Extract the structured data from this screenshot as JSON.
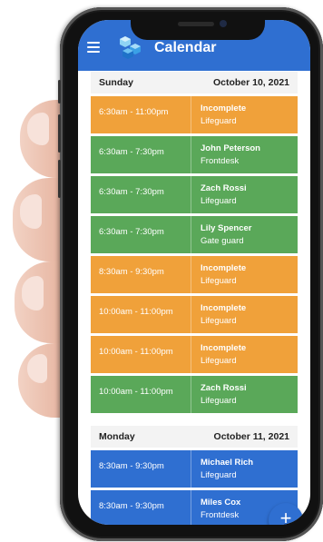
{
  "app": {
    "title": "Calendar",
    "menu_icon": "menu-icon",
    "logo_icon": "cubes-logo-icon"
  },
  "colors": {
    "primary": "#2f6fd1",
    "incomplete": "#f0a13a",
    "assigned": "#5aa859",
    "header_bg": "#f3f3f3"
  },
  "days": [
    {
      "day": "Sunday",
      "date": "October 10, 2021",
      "shifts": [
        {
          "time": "6:30am - 11:00pm",
          "name": "Incomplete",
          "role": "Lifeguard",
          "status": "incomplete"
        },
        {
          "time": "6:30am - 7:30pm",
          "name": "John Peterson",
          "role": "Frontdesk",
          "status": "assigned"
        },
        {
          "time": "6:30am - 7:30pm",
          "name": "Zach Rossi",
          "role": "Lifeguard",
          "status": "assigned"
        },
        {
          "time": "6:30am - 7:30pm",
          "name": "Lily Spencer",
          "role": "Gate guard",
          "status": "assigned"
        },
        {
          "time": "8:30am - 9:30pm",
          "name": "Incomplete",
          "role": "Lifeguard",
          "status": "incomplete"
        },
        {
          "time": "10:00am - 11:00pm",
          "name": "Incomplete",
          "role": "Lifeguard",
          "status": "incomplete"
        },
        {
          "time": "10:00am - 11:00pm",
          "name": "Incomplete",
          "role": "Lifeguard",
          "status": "incomplete"
        },
        {
          "time": "10:00am - 11:00pm",
          "name": "Zach Rossi",
          "role": "Lifeguard",
          "status": "assigned"
        }
      ]
    },
    {
      "day": "Monday",
      "date": "October 11, 2021",
      "shifts": [
        {
          "time": "8:30am - 9:30pm",
          "name": "Michael Rich",
          "role": "Lifeguard",
          "status": "primary"
        },
        {
          "time": "8:30am - 9:30pm",
          "name": "Miles Cox",
          "role": "Frontdesk",
          "status": "primary"
        }
      ]
    }
  ],
  "fab": {
    "label": "+",
    "icon": "plus-icon"
  }
}
